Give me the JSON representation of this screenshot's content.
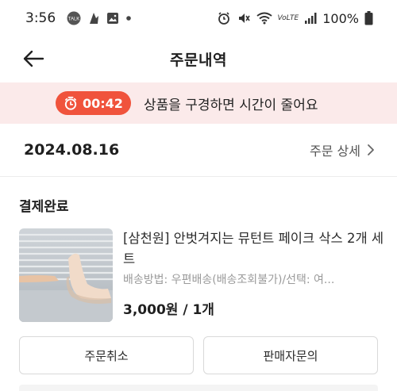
{
  "status_bar": {
    "time": "3:56",
    "talk_badge": "TALK",
    "volte": "VoLTE",
    "battery": "100%"
  },
  "header": {
    "title": "주문내역"
  },
  "banner": {
    "timer": "00:42",
    "message": "상품을 구경하면 시간이 줄어요"
  },
  "order": {
    "date": "2024.08.16",
    "detail_label": "주문 상세",
    "status": "결제완료",
    "item": {
      "title": "[삼천원] 안벗겨지는 뮤턴트 페이크 삭스 2개 세트",
      "option": "배송방법: 우편배송(배송조회불가)/선택: 여...",
      "price": "3,000원 / 1개"
    },
    "actions": {
      "cancel_label": "주문취소",
      "inquiry_label": "판매자문의"
    }
  },
  "colors": {
    "accent": "#f0533c",
    "banner_bg": "#fbeaea"
  }
}
